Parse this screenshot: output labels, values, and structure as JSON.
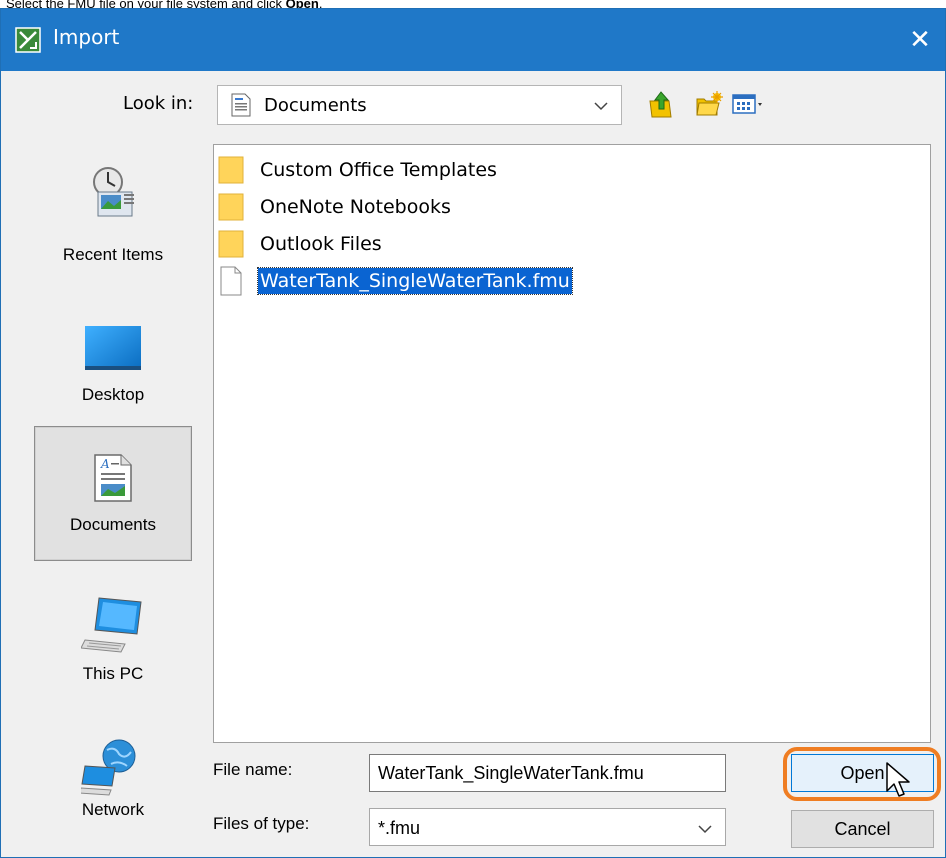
{
  "caption": {
    "prefix": "Select the FMU file on your file system and click ",
    "emphasis": "Open",
    "suffix": "."
  },
  "window": {
    "title": "Import",
    "close_glyph": "✕"
  },
  "look_in": {
    "label": "Look in:",
    "value": "Documents"
  },
  "toolbar": {
    "up_icon": "folder-up-icon",
    "new_folder_icon": "new-folder-icon",
    "view_icon": "view-menu-icon"
  },
  "places": [
    {
      "label": "Recent Items",
      "icon": "recent-items-icon"
    },
    {
      "label": "Desktop",
      "icon": "desktop-icon"
    },
    {
      "label": "Documents",
      "icon": "documents-icon",
      "selected": true
    },
    {
      "label": "This PC",
      "icon": "this-pc-icon"
    },
    {
      "label": "Network",
      "icon": "network-icon"
    }
  ],
  "files": [
    {
      "name": "Custom Office Templates",
      "type": "folder"
    },
    {
      "name": "OneNote Notebooks",
      "type": "folder"
    },
    {
      "name": "Outlook Files",
      "type": "folder"
    },
    {
      "name": "WaterTank_SingleWaterTank.fmu",
      "type": "file",
      "selected": true
    }
  ],
  "file_name": {
    "label": "File name:",
    "value": "WaterTank_SingleWaterTank.fmu"
  },
  "file_type": {
    "label": "Files of type:",
    "value": "*.fmu"
  },
  "buttons": {
    "open": "Open",
    "cancel": "Cancel"
  },
  "colors": {
    "titlebar": "#1f78c8",
    "selection": "#0a64d2",
    "highlight_ring": "#ef7d22"
  }
}
